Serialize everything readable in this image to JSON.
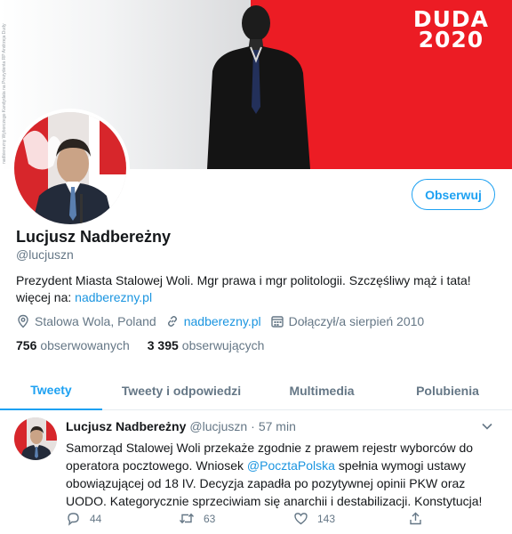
{
  "banner": {
    "credit_text": "nadbierezny Wyborczego Kandydata na Prezydenta RP Andrzeja Dudy",
    "brand_line1": "DUDA",
    "brand_line2": "2020",
    "accent_color": "#ec1c24"
  },
  "profile": {
    "display_name": "Lucjusz Nadbereżny",
    "handle": "@lucjuszn",
    "follow_label": "Obserwuj",
    "bio_text": "Prezydent Miasta Stalowej Woli. Mgr prawa i mgr politologii. Szczęśliwy mąż i tata!",
    "bio_link_prefix": "więcej na: ",
    "bio_link": "nadberezny.pl",
    "location": "Stalowa Wola, Poland",
    "website": "nadberezny.pl",
    "joined": "Dołączył/a sierpień 2010",
    "following_count": "756",
    "following_label": "obserwowanych",
    "followers_count": "3 395",
    "followers_label": "obserwujących"
  },
  "tabs": [
    {
      "label": "Tweety",
      "active": true
    },
    {
      "label": "Tweety i odpowiedzi",
      "active": false
    },
    {
      "label": "Multimedia",
      "active": false
    },
    {
      "label": "Polubienia",
      "active": false
    }
  ],
  "tweet": {
    "author": "Lucjusz Nadbereżny",
    "handle": "@lucjuszn",
    "separator": "·",
    "time": "57 min",
    "text_part1": "Samorząd Stalowej Woli przekaże zgodnie z prawem rejestr wyborców do operatora pocztowego. Wniosek ",
    "mention": "@PocztaPolska",
    "text_part2": " spełnia wymogi ustawy obowiązującej od 18 IV. Decyzja zapadła po pozytywnej opinii PKW oraz UODO. Kategorycznie sprzeciwiam się anarchii i destabilizacji. Konstytucja!",
    "replies": "44",
    "retweets": "63",
    "likes": "143"
  },
  "colors": {
    "link": "#1b95e0",
    "accent": "#1da1f2",
    "secondary_text": "#657786"
  }
}
